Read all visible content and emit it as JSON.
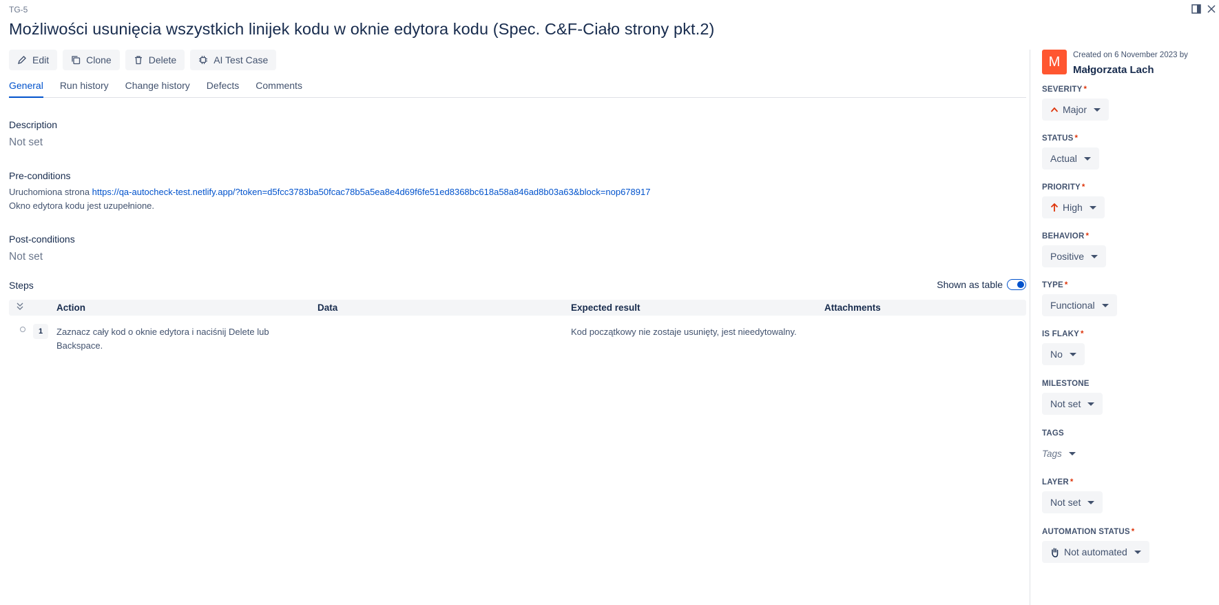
{
  "case_key": "TG-5",
  "title": "Możliwości usunięcia wszystkich linijek kodu w oknie edytora kodu (Spec. C&F-Ciało strony pkt.2)",
  "toolbar": {
    "edit": "Edit",
    "clone": "Clone",
    "delete": "Delete",
    "ai_test_case": "AI Test Case"
  },
  "tabs": [
    "General",
    "Run history",
    "Change history",
    "Defects",
    "Comments"
  ],
  "active_tab": "General",
  "description": {
    "label": "Description",
    "value": "Not set"
  },
  "preconditions": {
    "label": "Pre-conditions",
    "line1_prefix": "Uruchomiona strona ",
    "link": "https://qa-autocheck-test.netlify.app/?token=d5fcc3783ba50fcac78b5a5ea8e4d69f6fe51ed8368bc618a58a846ad8b03a63&block=nop678917",
    "line2": "Okno edytora kodu jest uzupełnione."
  },
  "postconditions": {
    "label": "Post-conditions",
    "value": "Not set"
  },
  "steps": {
    "label": "Steps",
    "toggle_label": "Shown as table",
    "columns": {
      "action": "Action",
      "data": "Data",
      "expected": "Expected result",
      "attachments": "Attachments"
    },
    "rows": [
      {
        "num": "1",
        "action": "Zaznacz cały kod o oknie edytora i naciśnij Delete lub Backspace.",
        "data": "",
        "expected": "Kod początkowy nie zostaje usunięty, jest nieedytowalny."
      }
    ]
  },
  "sidebar": {
    "avatar_letter": "M",
    "avatar_color": "#ff5630",
    "created": "Created on 6 November 2023 by",
    "author": "Małgorzata Lach",
    "fields": {
      "severity": {
        "label": "SEVERITY",
        "value": "Major",
        "icon": "chevron-up-icon"
      },
      "status": {
        "label": "STATUS",
        "value": "Actual"
      },
      "priority": {
        "label": "PRIORITY",
        "value": "High",
        "icon": "arrow-up-icon"
      },
      "behavior": {
        "label": "BEHAVIOR",
        "value": "Positive"
      },
      "type": {
        "label": "TYPE",
        "value": "Functional"
      },
      "is_flaky": {
        "label": "IS FLAKY",
        "value": "No"
      },
      "milestone": {
        "label": "MILESTONE",
        "value": "Not set"
      },
      "tags": {
        "label": "TAGS",
        "value": "Tags"
      },
      "layer": {
        "label": "LAYER",
        "value": "Not set"
      },
      "automation_status": {
        "label": "AUTOMATION STATUS",
        "value": "Not automated",
        "icon": "hand-icon"
      }
    }
  },
  "colors": {
    "accent": "#0052cc",
    "required": "#de350b",
    "priority_red": "#de350b"
  }
}
